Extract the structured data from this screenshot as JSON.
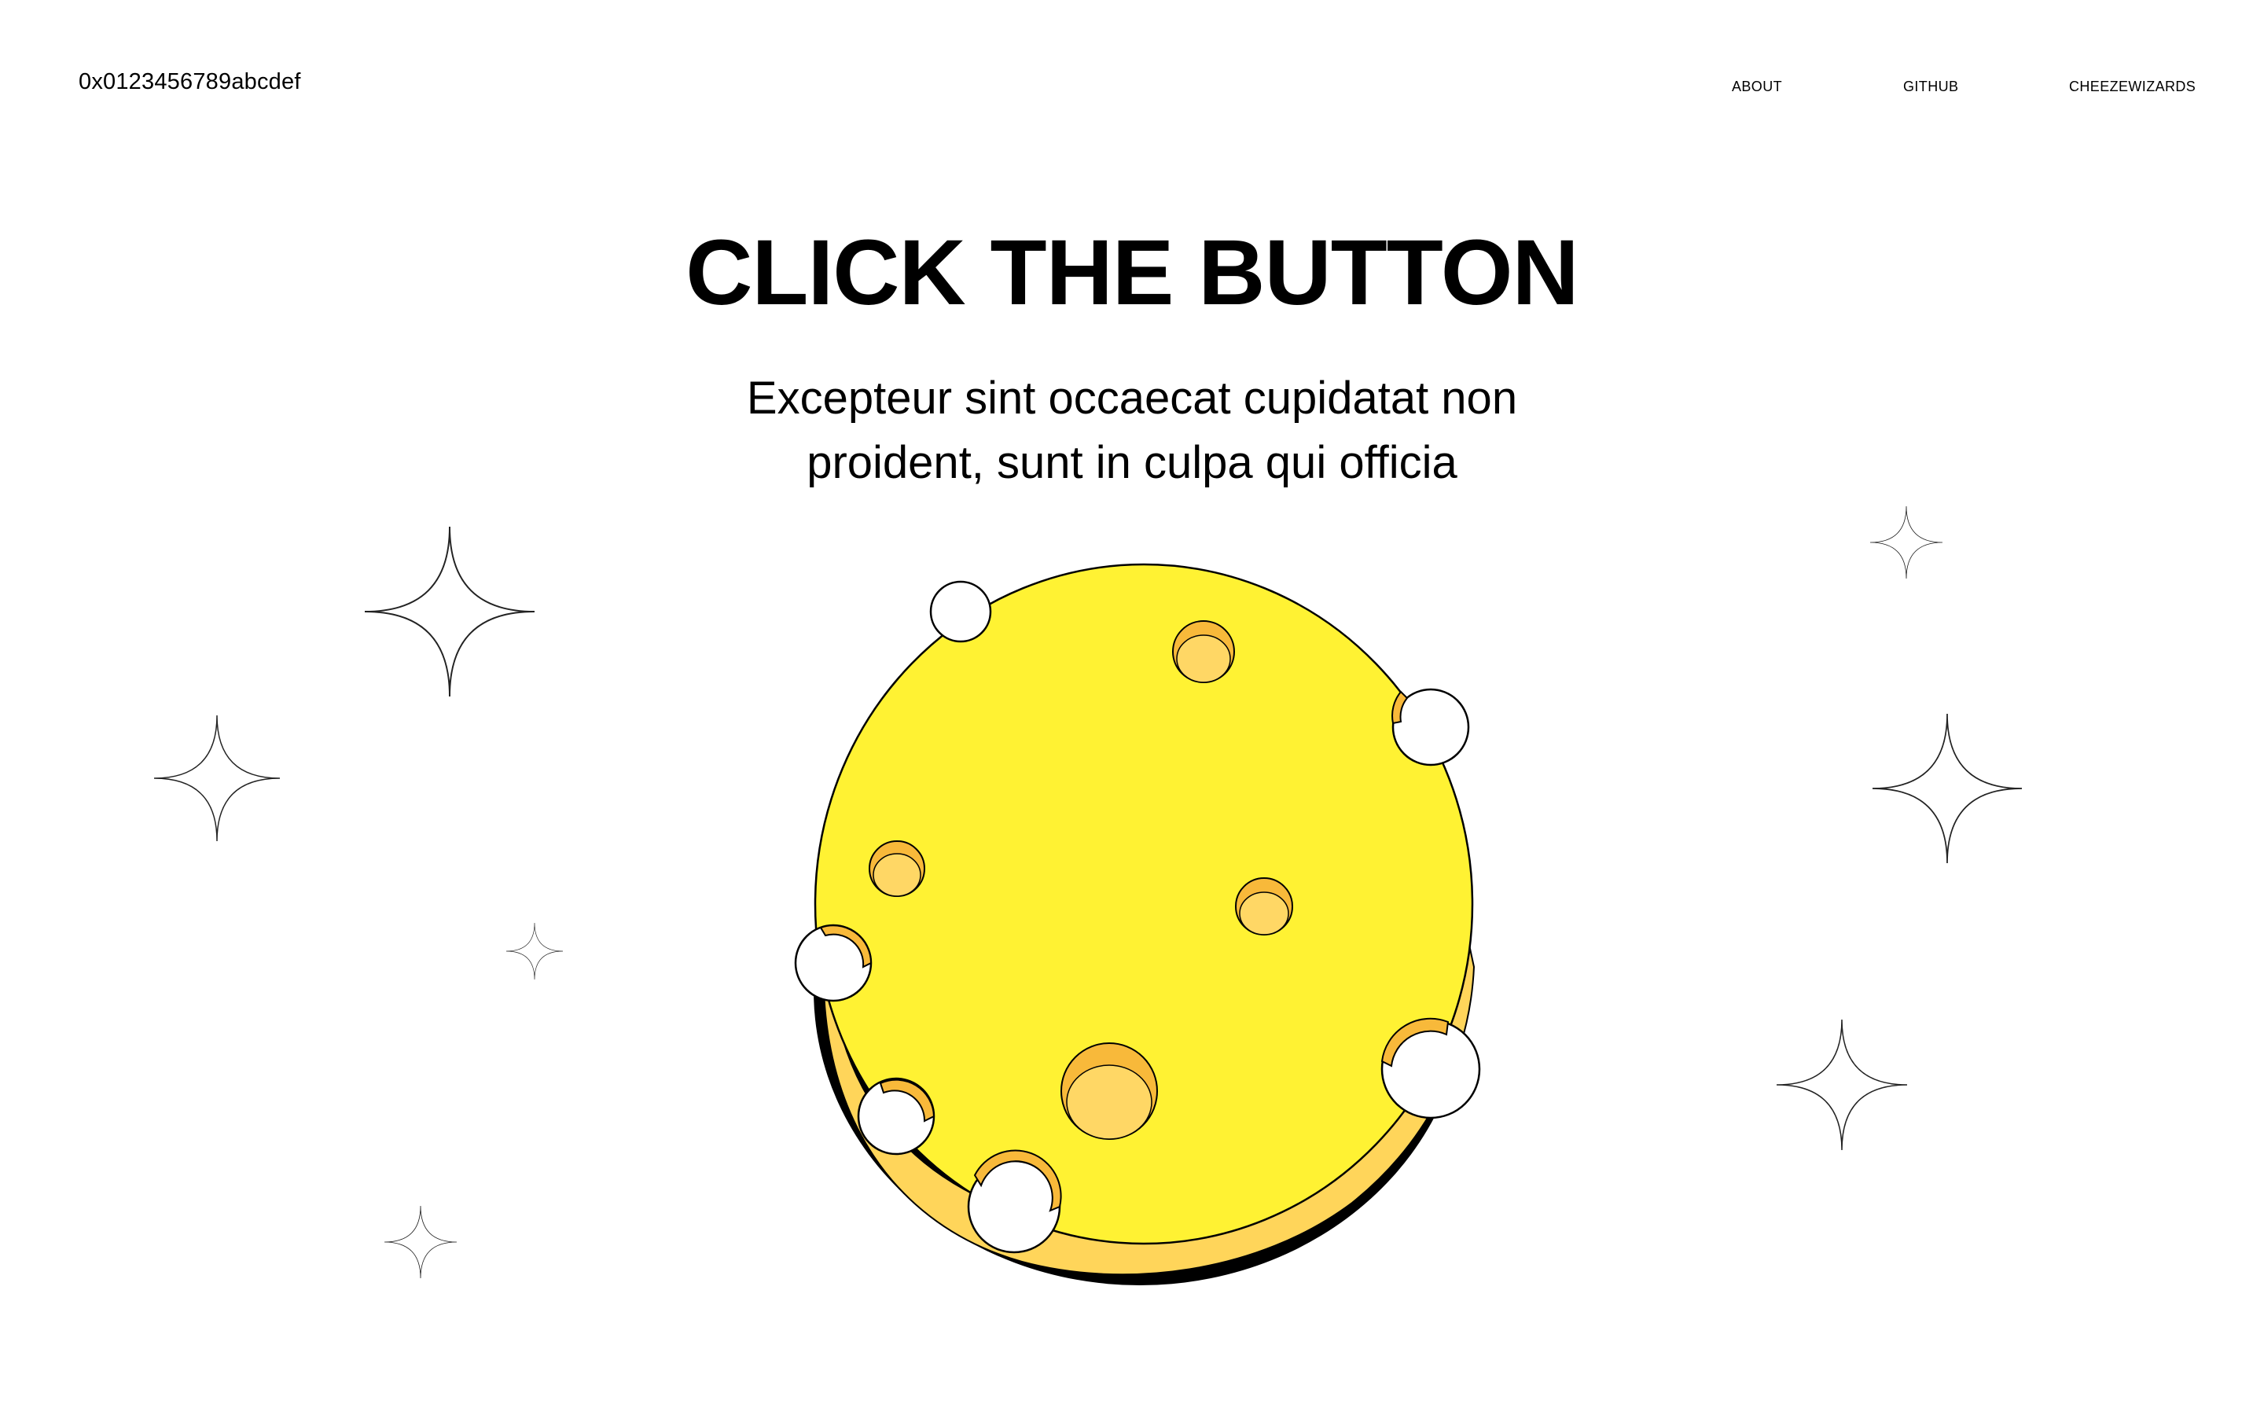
{
  "header": {
    "wallet_address": "0x0123456789abcdef",
    "nav": [
      {
        "label": "ABOUT"
      },
      {
        "label": "GITHUB"
      },
      {
        "label": "CHEEZEWIZARDS"
      }
    ]
  },
  "hero": {
    "title": "CLICK THE BUTTON",
    "subtitle_lines": [
      "Excepteur sint occaecat cupidatat non",
      "proident, sunt in culpa qui officia"
    ]
  },
  "icons": {
    "button": "cheese-wheel-icon",
    "decoration": "sparkle-icon"
  },
  "colors": {
    "background": "#ffffff",
    "cheese_top": "#fff233",
    "cheese_side": "#ffd55a",
    "cheese_hole": "#ffd765",
    "cheese_hole_wall": "#f8b93a",
    "shadow": "#000000"
  }
}
